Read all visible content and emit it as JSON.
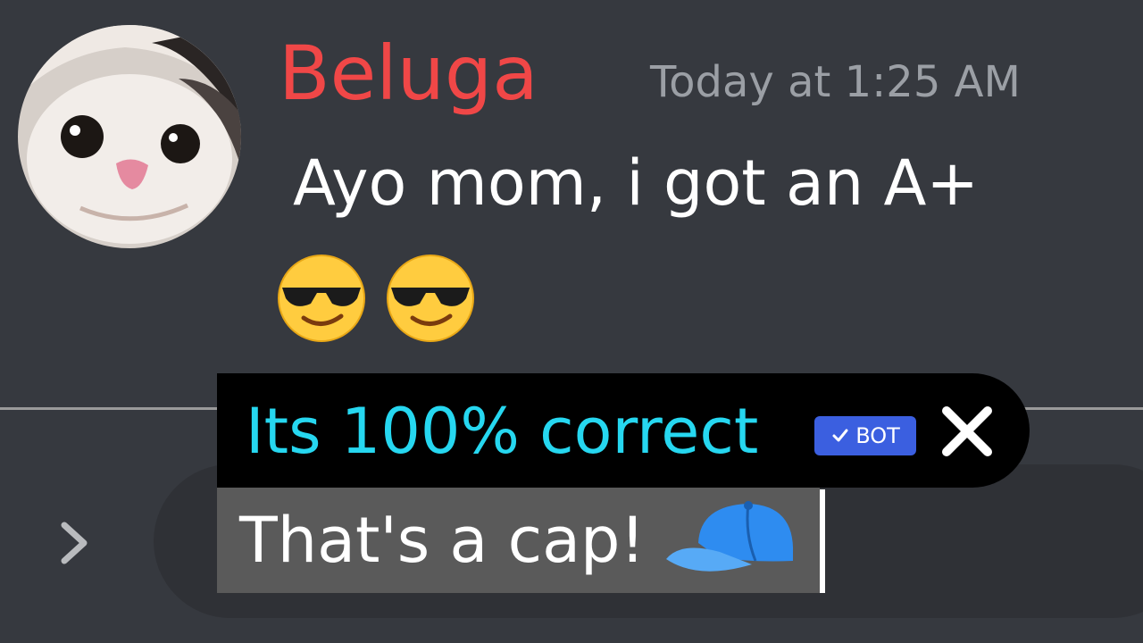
{
  "message": {
    "author": "Beluga",
    "timestamp": "Today at 1:25 AM",
    "text": "Ayo mom, i got an A+",
    "emojis": [
      "smiling-face-with-sunglasses",
      "smiling-face-with-sunglasses"
    ],
    "author_color": "#f04747"
  },
  "reply": {
    "text": "Its 100% correct",
    "badge": "BOT",
    "badge_icon": "checkmark-icon",
    "close_icon": "close-icon",
    "text_color": "#26d7f0",
    "badge_color": "#3b5fe0"
  },
  "composer": {
    "value": "That's a cap!",
    "emoji": "billed-cap",
    "expand_icon": "chevron-right-icon"
  }
}
